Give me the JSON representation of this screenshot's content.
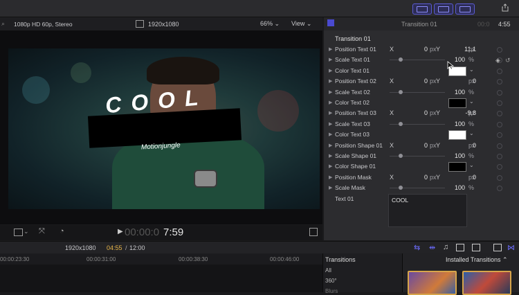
{
  "top_toolbar": {
    "buttons": [
      "grid-icon",
      "filmstrip-icon",
      "sliders-icon"
    ],
    "share_icon": "share-icon",
    "accent": "#5b5bd6"
  },
  "viewer": {
    "format": "1080p HD 60p, Stereo",
    "resolution": "1920x1080",
    "zoom": "66%",
    "view_menu": "View",
    "timecode_dim": "00:00:0",
    "timecode": "7:59",
    "overlay_title": "COOL",
    "overlay_subtitle": "Motionjungle"
  },
  "inspector": {
    "header_title": "Transition 01",
    "header_time_dim": "00:0",
    "header_time": "4:55",
    "section_title": "Transition 01",
    "rows": [
      {
        "label": "Position Text 01",
        "type": "xy",
        "x": "0",
        "y": "11,1",
        "unit": "px"
      },
      {
        "label": "Scale Text 01",
        "type": "scale",
        "value": "100",
        "unit": "%"
      },
      {
        "label": "Color Text 01",
        "type": "color",
        "color": "#ffffff"
      },
      {
        "label": "Position Text 02",
        "type": "xy",
        "x": "0",
        "y": "0",
        "unit": "px"
      },
      {
        "label": "Scale Text 02",
        "type": "scale",
        "value": "100",
        "unit": "%"
      },
      {
        "label": "Color Text 02",
        "type": "color",
        "color": "#000000"
      },
      {
        "label": "Position Text 03",
        "type": "xy",
        "x": "0",
        "y": "-9,8",
        "unit": "px"
      },
      {
        "label": "Scale Text 03",
        "type": "scale",
        "value": "100",
        "unit": "%"
      },
      {
        "label": "Color Text 03",
        "type": "color",
        "color": "#ffffff"
      },
      {
        "label": "Position Shape 01",
        "type": "xy",
        "x": "0",
        "y": "0",
        "unit": "px"
      },
      {
        "label": "Scale Shape 01",
        "type": "scale",
        "value": "100",
        "unit": "%"
      },
      {
        "label": "Color Shape 01",
        "type": "color",
        "color": "#000000"
      },
      {
        "label": "Position Mask",
        "type": "xy",
        "x": "0",
        "y": "0",
        "unit": "px"
      },
      {
        "label": "Scale Mask",
        "type": "scale",
        "value": "100",
        "unit": "%"
      }
    ],
    "x_label": "X",
    "y_label": "Y",
    "text_label": "Text 01",
    "text_value": "COOL"
  },
  "timeline": {
    "resolution": "1920x1080",
    "position": "04:55",
    "duration": "12:00",
    "ruler": [
      "00:00:23:30",
      "00:00:31:00",
      "00:00:38:30",
      "00:00:46:00"
    ]
  },
  "transitions_browser": {
    "title": "Transitions",
    "categories": [
      "All",
      "360°",
      "Blurs"
    ],
    "installed_label": "Installed Transitions"
  }
}
